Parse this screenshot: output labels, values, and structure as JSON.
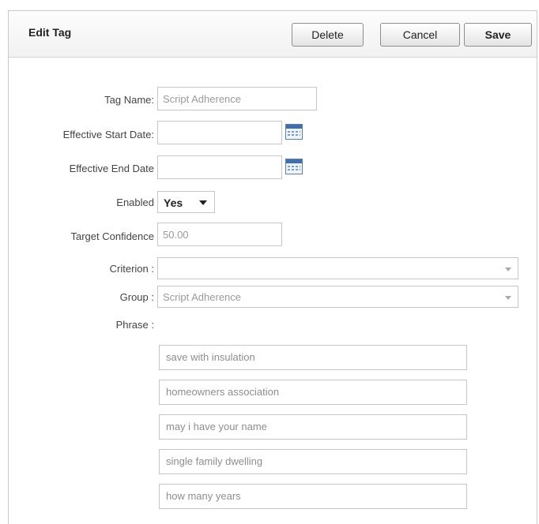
{
  "header": {
    "title": "Edit Tag",
    "delete_label": "Delete",
    "cancel_label": "Cancel",
    "save_label": "Save"
  },
  "form": {
    "tag_name": {
      "label": "Tag Name:",
      "value": "Script Adherence"
    },
    "start_date": {
      "label": "Effective Start Date:",
      "value": ""
    },
    "end_date": {
      "label": "Effective End Date",
      "value": ""
    },
    "enabled": {
      "label": "Enabled",
      "value": "Yes"
    },
    "target_confidence": {
      "label": "Target Confidence",
      "value": "50.00"
    },
    "criterion": {
      "label": "Criterion :",
      "value": ""
    },
    "group": {
      "label": "Group :",
      "value": "Script Adherence"
    },
    "phrase": {
      "label": "Phrase :"
    }
  },
  "phrases": [
    "save with insulation",
    "homeowners association",
    "may i have your name",
    "single family dwelling",
    "how many years"
  ],
  "icons": {
    "calendar": "calendar-icon",
    "dropdown": "chevron-down-icon"
  },
  "colors": {
    "calendar_accent": "#3f6fb2",
    "border": "#c6c6c6"
  }
}
